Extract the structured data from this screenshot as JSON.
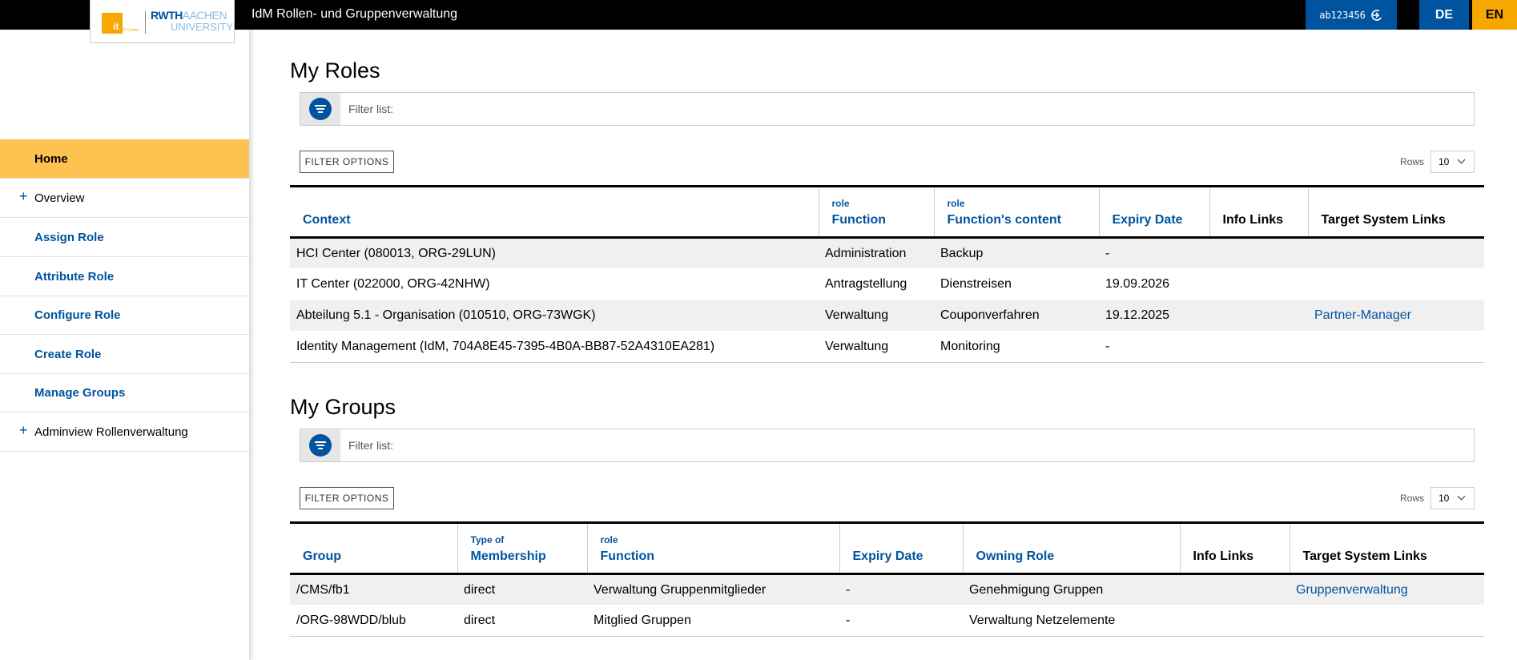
{
  "header": {
    "app_title": "IdM Rollen- und Gruppenverwaltung",
    "logo": {
      "it_text": "it",
      "it_subtext": "IT Center",
      "rwth": "RWTH",
      "aachen": "AACHEN",
      "university": "UNIVERSITY"
    },
    "user_id": "ab123456",
    "lang_de": "DE",
    "lang_en": "EN"
  },
  "sidebar": {
    "items": [
      {
        "label": "Home",
        "state": "active"
      },
      {
        "label": "Overview",
        "expandable": true
      },
      {
        "label": "Assign Role"
      },
      {
        "label": "Attribute Role"
      },
      {
        "label": "Configure Role"
      },
      {
        "label": "Create Role"
      },
      {
        "label": "Manage Groups"
      },
      {
        "label": "Adminview Rollenverwaltung",
        "expandable": true
      }
    ],
    "plus_glyph": "+"
  },
  "roles": {
    "title": "My Roles",
    "filter_placeholder": "Filter list:",
    "filter_options_label": "FILTER OPTIONS",
    "rows_label": "Rows",
    "rows_value": "10",
    "columns": [
      {
        "sup": "",
        "label": "Context"
      },
      {
        "sup": "role",
        "label": "Function"
      },
      {
        "sup": "role",
        "label": "Function's content"
      },
      {
        "sup": "",
        "label": "Expiry Date"
      },
      {
        "sup": "",
        "label": "Info Links"
      },
      {
        "sup": "",
        "label": "Target System Links"
      }
    ],
    "rows": [
      [
        "HCI Center (080013, ORG-29LUN)",
        "Administration",
        "Backup",
        "-",
        "",
        ""
      ],
      [
        "IT Center (022000, ORG-42NHW)",
        "Antragstellung",
        "Dienstreisen",
        "19.09.2026",
        "",
        ""
      ],
      [
        "Abteilung 5.1 - Organisation (010510, ORG-73WGK)",
        "Verwaltung",
        "Couponverfahren",
        "19.12.2025",
        "",
        "Partner-Manager"
      ],
      [
        "Identity Management (IdM, 704A8E45-7395-4B0A-BB87-52A4310EA281)",
        "Verwaltung",
        "Monitoring",
        "-",
        "",
        ""
      ]
    ]
  },
  "groups": {
    "title": "My Groups",
    "filter_placeholder": "Filter list:",
    "filter_options_label": "FILTER OPTIONS",
    "rows_label": "Rows",
    "rows_value": "10",
    "columns": [
      {
        "sup": "",
        "label": "Group"
      },
      {
        "sup": "Type of",
        "label": "Membership"
      },
      {
        "sup": "role",
        "label": "Function"
      },
      {
        "sup": "",
        "label": "Expiry Date"
      },
      {
        "sup": "",
        "label": "Owning Role"
      },
      {
        "sup": "",
        "label": "Info Links"
      },
      {
        "sup": "",
        "label": "Target System Links"
      }
    ],
    "rows": [
      [
        "/CMS/fb1",
        "direct",
        "Verwaltung Gruppenmitglieder",
        "-",
        "Genehmigung Gruppen",
        "",
        "Gruppenverwaltung"
      ],
      [
        "/ORG-98WDD/blub",
        "direct",
        "Mitglied Gruppen",
        "-",
        "Verwaltung Netzelemente",
        "",
        ""
      ]
    ]
  },
  "colors": {
    "brand_blue": "#00549f",
    "accent_orange": "#f6a800",
    "active_nav": "#fdc250"
  }
}
